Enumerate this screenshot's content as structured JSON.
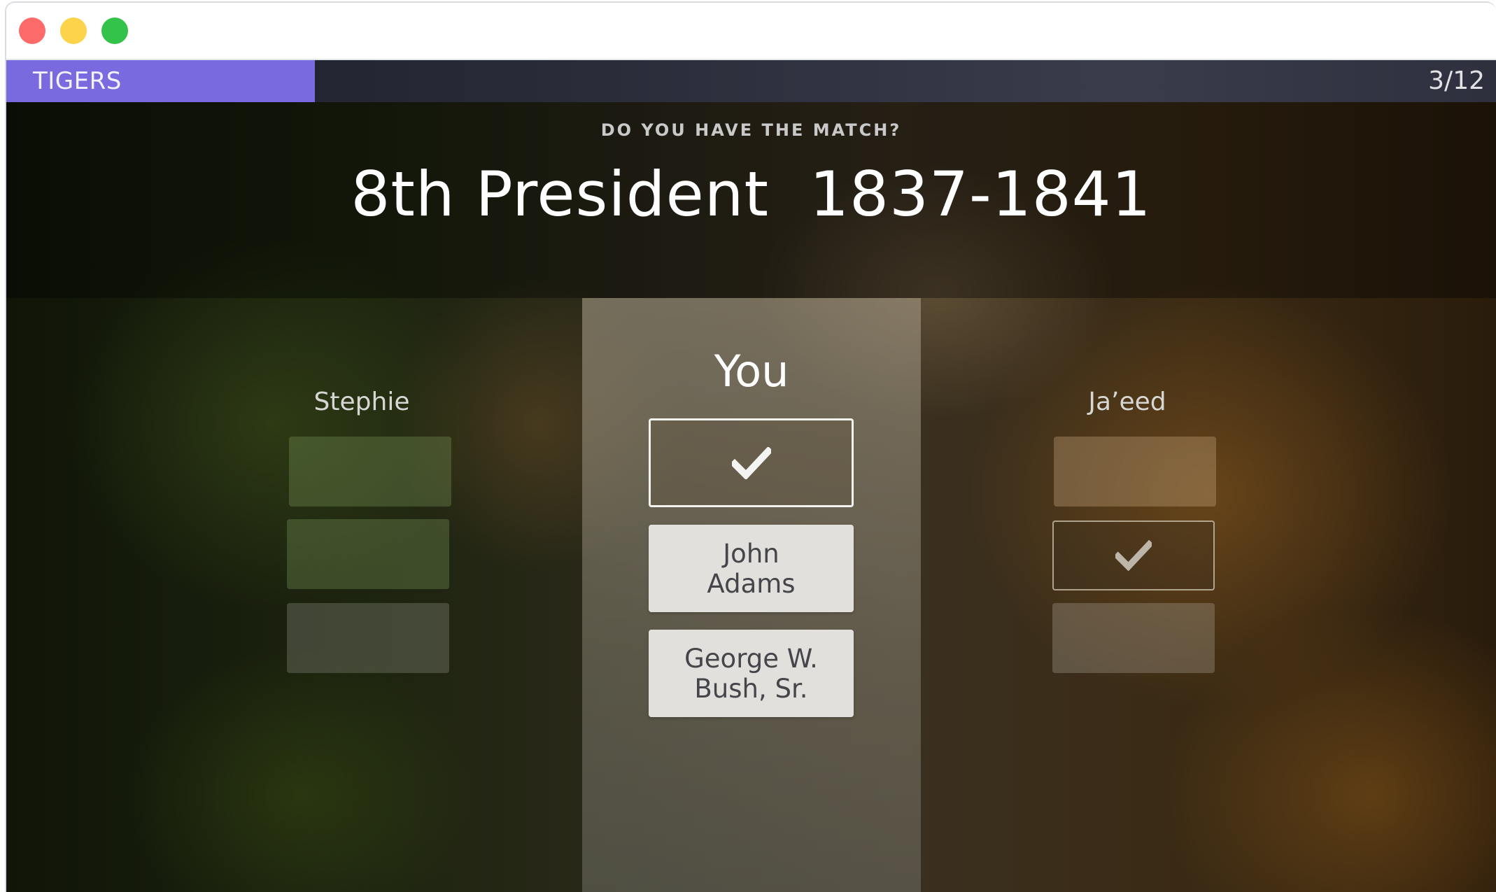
{
  "window": {
    "controls": [
      "close",
      "minimize",
      "maximize"
    ]
  },
  "topbar": {
    "team_name": "TIGERS",
    "progress": "3/12",
    "team_color": "#7a6adf"
  },
  "question": {
    "prompt": "DO YOU HAVE THE MATCH?",
    "clue": "8th President  1837-1841"
  },
  "players": {
    "left": {
      "name": "Stephie",
      "slots": [
        "empty",
        "empty",
        "empty"
      ]
    },
    "you": {
      "name": "You",
      "selected": "check",
      "options": [
        "John\nAdams",
        "George W.\nBush, Sr."
      ]
    },
    "right": {
      "name": "Ja’eed",
      "slots": [
        "empty",
        "check",
        "empty"
      ]
    }
  }
}
